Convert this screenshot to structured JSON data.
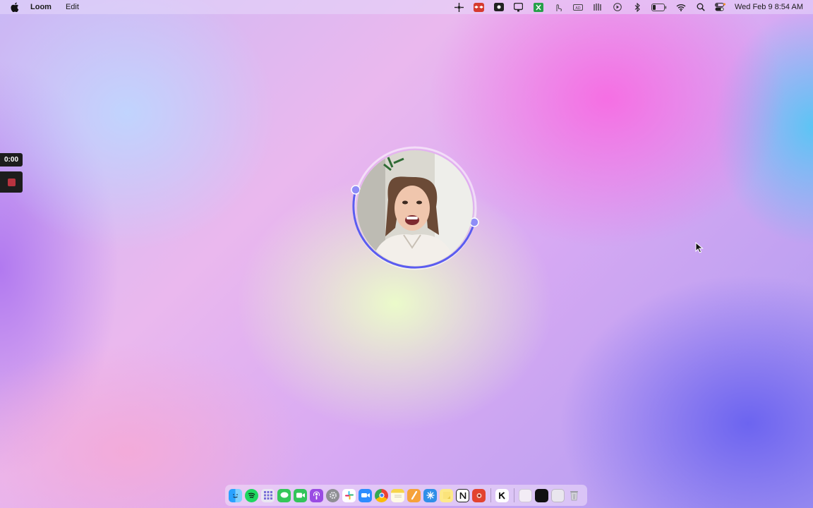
{
  "menubar": {
    "app_name": "Loom",
    "menus": [
      "Edit"
    ],
    "clock": "Wed Feb 9  8:54 AM",
    "status_icons": [
      "loom-icon",
      "dropbox-icon",
      "screen-record-icon",
      "screenshot-icon",
      "keyboard-icon",
      "touch-icon",
      "camera-off-icon",
      "audio-icon",
      "play-icon",
      "bluetooth-icon",
      "battery-icon",
      "wifi-icon",
      "search-icon",
      "control-center-icon"
    ]
  },
  "recorder": {
    "timer": "0:00",
    "stop_color": "#b8333f",
    "ring_color": "#5b5cf0"
  },
  "dock": {
    "apps": [
      "finder",
      "spotify",
      "launchpad",
      "messages",
      "facetime",
      "podcasts",
      "system-preferences",
      "slack",
      "zoom",
      "chrome",
      "notes",
      "pages",
      "perplexity",
      "stickies",
      "notion",
      "photo-booth",
      "klack"
    ],
    "recent": [
      "window-1",
      "window-2",
      "window-3"
    ],
    "trash": "trash"
  }
}
